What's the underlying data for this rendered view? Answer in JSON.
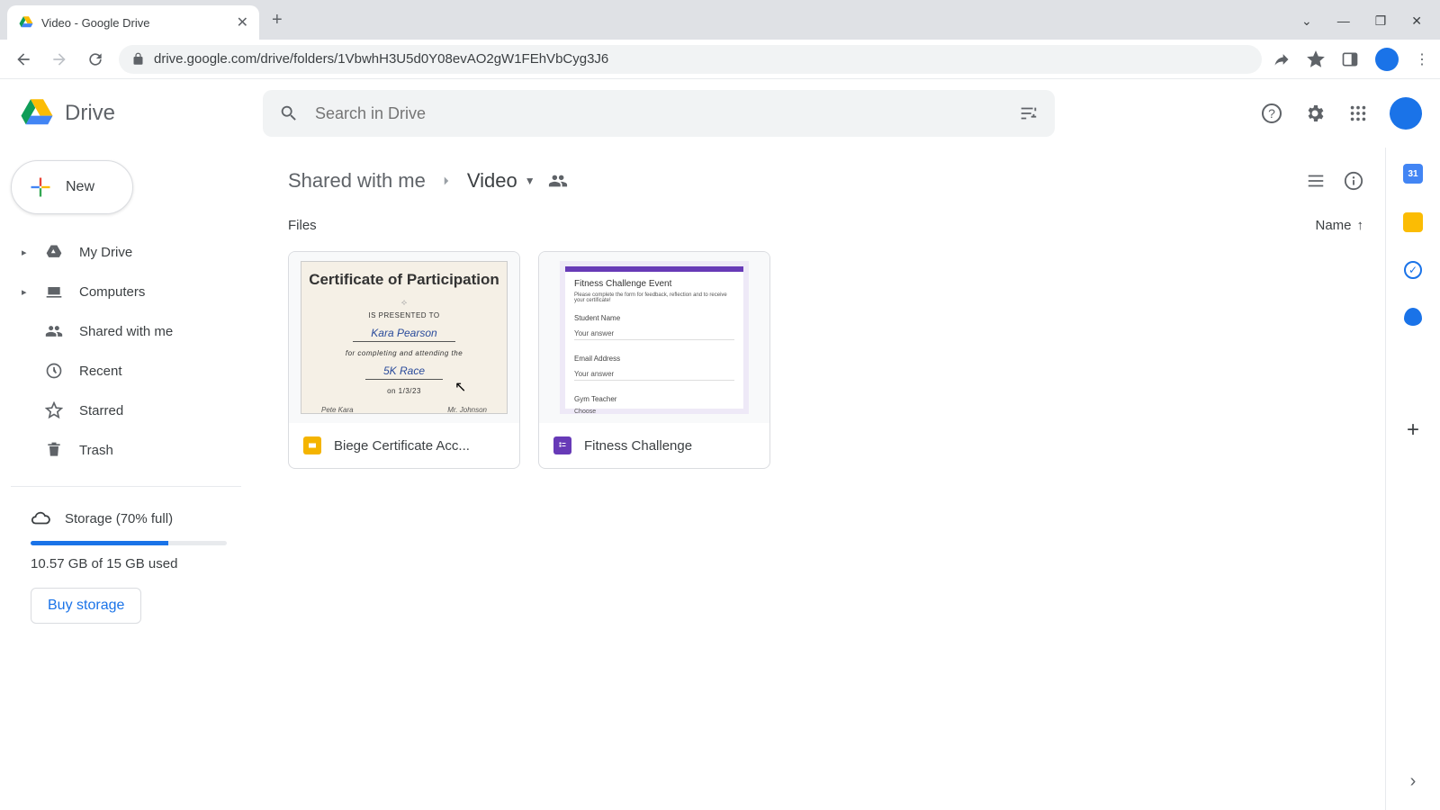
{
  "browser": {
    "tab_title": "Video - Google Drive",
    "url": "drive.google.com/drive/folders/1VbwhH3U5d0Y08evAO2gW1FEhVbCyg3J6"
  },
  "app": {
    "logo_text": "Drive",
    "search_placeholder": "Search in Drive"
  },
  "sidebar": {
    "new_label": "New",
    "items": [
      {
        "label": "My Drive",
        "icon": "drive",
        "expandable": true
      },
      {
        "label": "Computers",
        "icon": "computers",
        "expandable": true
      },
      {
        "label": "Shared with me",
        "icon": "shared",
        "expandable": false
      },
      {
        "label": "Recent",
        "icon": "recent",
        "expandable": false
      },
      {
        "label": "Starred",
        "icon": "starred",
        "expandable": false
      },
      {
        "label": "Trash",
        "icon": "trash",
        "expandable": false
      }
    ],
    "storage": {
      "label": "Storage (70% full)",
      "percent": 70,
      "used_text": "10.57 GB of 15 GB used",
      "buy_label": "Buy storage"
    }
  },
  "breadcrumb": {
    "parent": "Shared with me",
    "current": "Video"
  },
  "content": {
    "section_label": "Files",
    "sort_label": "Name",
    "files": [
      {
        "name": "Biege Certificate Acc...",
        "type": "slides"
      },
      {
        "name": "Fitness Challenge",
        "type": "forms"
      }
    ]
  },
  "thumb_cert": {
    "title": "Certificate of Participation",
    "presented": "IS PRESENTED TO",
    "recipient": "Kara Pearson",
    "for_line": "for completing and attending the",
    "event": "5K Race",
    "date": "on 1/3/23",
    "sig_left": "Pete Kara",
    "sig_right": "Mr. Johnson"
  },
  "thumb_form": {
    "title": "Fitness Challenge Event",
    "subtitle": "Please complete the form for feedback, reflection and to receive your certificate!",
    "field1": "Student Name",
    "field1_ph": "Your answer",
    "field2": "Email Address",
    "field2_ph": "Your answer",
    "field3": "Gym Teacher",
    "field3_ph": "Choose"
  },
  "sidepanel_cal_day": "31"
}
